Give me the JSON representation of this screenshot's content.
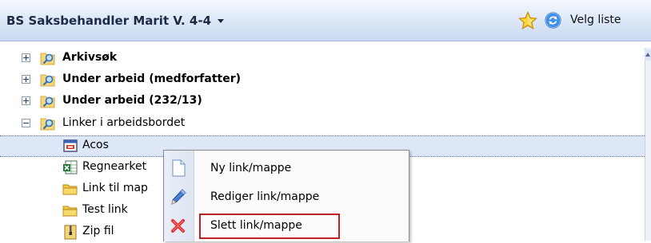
{
  "header": {
    "title": "BS Saksbehandler Marit V. 4-4",
    "velg_liste_label": "Velg liste"
  },
  "tree": {
    "nodes": [
      {
        "label": "Arkivsøk",
        "bold": true,
        "expander": "plus",
        "icon": "search-folder-icon"
      },
      {
        "label": "Under arbeid (medforfatter)",
        "bold": true,
        "expander": "plus",
        "icon": "search-folder-icon"
      },
      {
        "label": "Under arbeid (232/13)",
        "bold": true,
        "expander": "plus",
        "icon": "search-folder-icon"
      },
      {
        "label": "Linker i arbeidsbordet",
        "bold": false,
        "expander": "minus",
        "icon": "search-folder-icon"
      },
      {
        "label": "Acos",
        "bold": false,
        "selected": true,
        "icon": "application-icon"
      },
      {
        "label": "Regnearket",
        "bold": false,
        "icon": "spreadsheet-icon"
      },
      {
        "label": "Link til map",
        "bold": false,
        "icon": "folder-icon"
      },
      {
        "label": "Test link",
        "bold": false,
        "icon": "folder-icon"
      },
      {
        "label": "Zip fil",
        "bold": false,
        "icon": "zip-file-icon"
      }
    ]
  },
  "context_menu": {
    "items": [
      {
        "label": "Ny link/mappe",
        "icon": "new-document-icon"
      },
      {
        "label": "Rediger link/mappe",
        "icon": "pencil-icon"
      },
      {
        "label": "Slett link/mappe",
        "icon": "delete-x-icon",
        "highlighted": true
      }
    ]
  },
  "colors": {
    "selection": "#dde7f7",
    "highlight_box": "#c0202a",
    "header_text": "#1d2a44"
  }
}
